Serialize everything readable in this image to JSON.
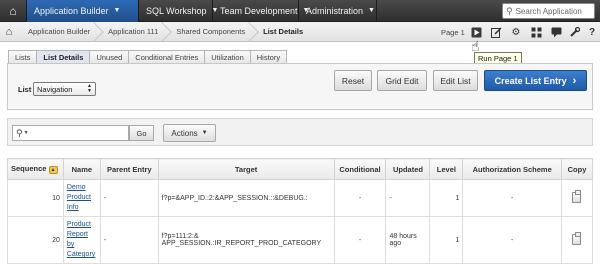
{
  "topnav": {
    "tabs": [
      {
        "label": "Application Builder"
      },
      {
        "label": "SQL Workshop"
      },
      {
        "label": "Team Development"
      },
      {
        "label": "Administration"
      }
    ],
    "search_placeholder": "Search Application"
  },
  "breadcrumb": [
    "Application Builder",
    "Application 111",
    "Shared Components",
    "List Details"
  ],
  "page_label": "Page 1",
  "tooltip": "Run Page 1",
  "tabs": [
    "Lists",
    "List Details",
    "Unused",
    "Conditional Entries",
    "Utilization",
    "History"
  ],
  "list_select": {
    "label": "List",
    "value": "Navigation"
  },
  "buttons": {
    "reset": "Reset",
    "grid_edit": "Grid Edit",
    "edit_list": "Edit List",
    "create": "Create List Entry"
  },
  "search": {
    "go": "Go",
    "actions": "Actions"
  },
  "table": {
    "headers": [
      "Sequence",
      "Name",
      "Parent Entry",
      "Target",
      "Conditional",
      "Updated",
      "Level",
      "Authorization Scheme",
      "Copy"
    ],
    "rows": [
      {
        "sequence": "10",
        "name": "Demo Product Info",
        "parent": "-",
        "target": "f?p=&APP_ID.:2:&APP_SESSION.::&DEBUG.:",
        "conditional": "-",
        "updated": "-",
        "level": "1",
        "auth": "-"
      },
      {
        "sequence": "20",
        "name": "Product Report by Category",
        "parent": "-",
        "target": "f?p=111:2:& APP_SESSION.:IR_REPORT_PROD_CATEGORY",
        "conditional": "-",
        "updated": "48 hours ago",
        "level": "1",
        "auth": "-"
      }
    ]
  },
  "colors": {
    "nav_bg": "#3a3a3a",
    "nav_active": "#2a62ab",
    "primary_button": "#2a68b8",
    "link": "#1a4e98"
  }
}
